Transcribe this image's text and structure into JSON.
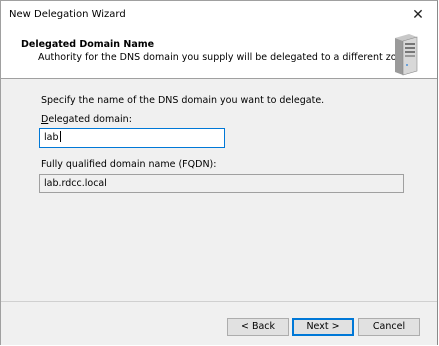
{
  "window": {
    "title": "New Delegation Wizard",
    "close_glyph": "✕"
  },
  "header": {
    "title": "Delegated Domain Name",
    "subtitle": "Authority for the DNS domain you supply will be delegated to a different zone.",
    "icon": "server-icon"
  },
  "form": {
    "instruction": "Specify the name of the DNS domain you want to delegate.",
    "domain_label_accel": "D",
    "domain_label_rest": "elegated domain:",
    "domain_value": "lab",
    "fqdn_label": "Fully qualified domain name (FQDN):",
    "fqdn_value": "lab.rdcc.local"
  },
  "buttons": {
    "back": "< Back",
    "next": "Next >",
    "cancel": "Cancel"
  },
  "colors": {
    "focus": "#0078d7",
    "dialog_bg": "#f0f0f0"
  }
}
